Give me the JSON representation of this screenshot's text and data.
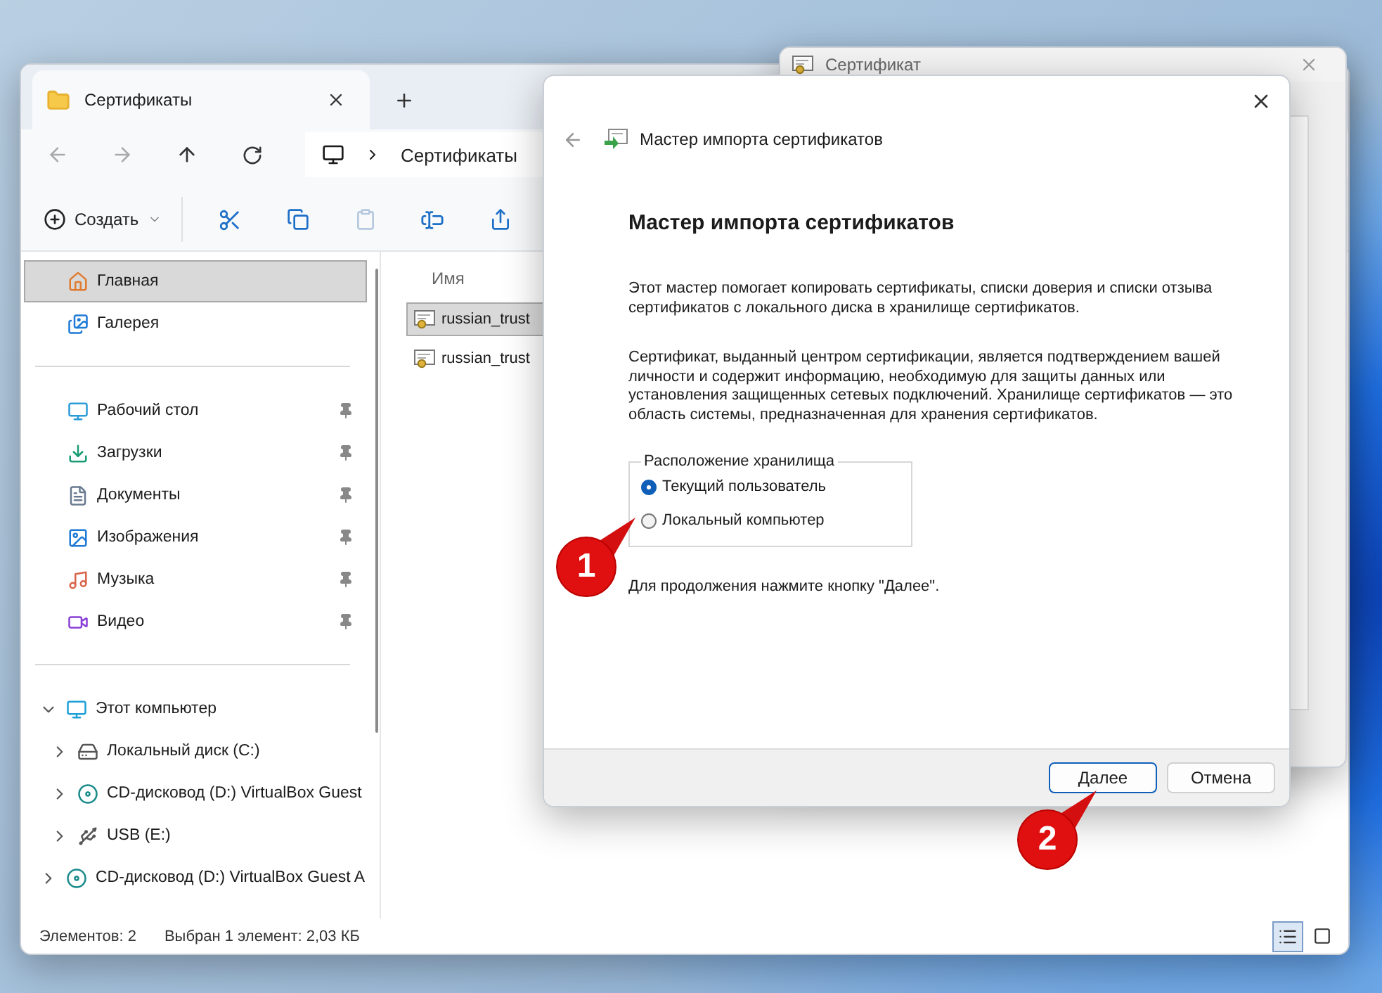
{
  "certificate_window": {
    "title": "Сертификат"
  },
  "explorer": {
    "tab": {
      "title": "Сертификаты"
    },
    "address": "Сертификаты",
    "toolbar": {
      "new_label": "Создать"
    },
    "sidebar": {
      "quick_access": [
        {
          "label": "Главная",
          "kind": "home",
          "selected": true
        },
        {
          "label": "Галерея",
          "kind": "gallery",
          "selected": false
        }
      ],
      "pinned": [
        {
          "label": "Рабочий стол",
          "kind": "desktop",
          "selected": false
        },
        {
          "label": "Загрузки",
          "kind": "downloads",
          "selected": false
        },
        {
          "label": "Документы",
          "kind": "documents",
          "selected": false
        },
        {
          "label": "Изображения",
          "kind": "pictures",
          "selected": false
        },
        {
          "label": "Музыка",
          "kind": "music",
          "selected": false
        },
        {
          "label": "Видео",
          "kind": "video",
          "selected": false
        }
      ],
      "tree": [
        {
          "label": "Этот компьютер",
          "kind": "computer",
          "expanded": true,
          "children": [
            {
              "label": "Локальный диск (C:)",
              "kind": "disk",
              "expanded": false
            },
            {
              "label": "CD-дисковод (D:) VirtualBox Guest",
              "kind": "cd",
              "expanded": false
            },
            {
              "label": "USB (E:)",
              "kind": "usb",
              "expanded": false
            }
          ]
        },
        {
          "label": "CD-дисковод (D:) VirtualBox Guest A",
          "kind": "cd",
          "expanded": false
        }
      ]
    },
    "files": {
      "column": "Имя",
      "rows": [
        {
          "name": "russian_trust",
          "selected": true
        },
        {
          "name": "russian_trust",
          "selected": false
        }
      ]
    },
    "status_bar": {
      "count": "Элементов: 2",
      "selection": "Выбран 1 элемент: 2,03 КБ"
    }
  },
  "wizard": {
    "title": "Мастер импорта сертификатов",
    "heading": "Мастер импорта сертификатов",
    "paragraphs": [
      "Этот мастер помогает копировать сертификаты, списки доверия и списки отзыва сертификатов с локального диска в хранилище сертификатов.",
      "Сертификат, выданный центром сертификации, является подтверждением вашей личности и содержит информацию, необходимую для защиты данных или установления защищенных сетевых подключений. Хранилище сертификатов — это область системы, предназначенная для хранения сертификатов."
    ],
    "group": {
      "label": "Расположение хранилища",
      "options": [
        {
          "label": "Текущий пользователь",
          "selected": true
        },
        {
          "label": "Локальный компьютер",
          "selected": false
        }
      ]
    },
    "hint": "Для продолжения нажмите кнопку \"Далее\".",
    "buttons": [
      {
        "label": "Далее",
        "default": true
      },
      {
        "label": "Отмена",
        "default": false
      }
    ]
  },
  "callouts": [
    {
      "number": "1"
    },
    {
      "number": "2"
    }
  ]
}
